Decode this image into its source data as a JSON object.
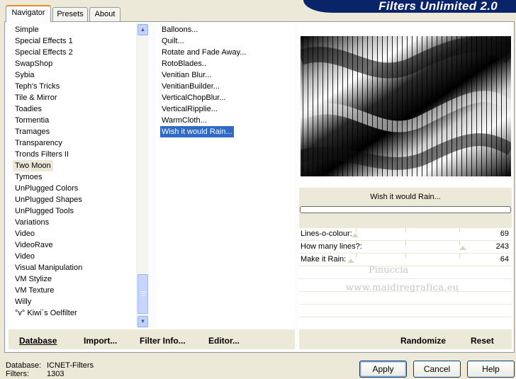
{
  "banner_title": "Filters Unlimited 2.0",
  "tabs": [
    "Navigator",
    "Presets",
    "About"
  ],
  "categories": [
    "Simple",
    "Special Effects 1",
    "Special Effects 2",
    "SwapShop",
    "Sybia",
    "Teph's Tricks",
    "Tile & Mirror",
    "Toadies",
    "Tormentia",
    "Tramages",
    "Transparency",
    "Tronds Filters II",
    "Two Moon",
    "Tymoes",
    "UnPlugged Colors",
    "UnPlugged Shapes",
    "UnPlugged Tools",
    "Variations",
    "Video",
    "VideoRave",
    "Video",
    "Visual Manipulation",
    "VM Stylize",
    "VM Texture",
    "Willy",
    "°v° Kiwi`s Oelfilter"
  ],
  "selected_category": "Two Moon",
  "filters": [
    "Balloons...",
    "Quilt...",
    "Rotate and Fade Away...",
    "RotoBlades..",
    "Venitian Blur...",
    "VenitianBuilder...",
    "VerticalChopBlur...",
    "VerticalRipplie...",
    "WarmCloth...",
    "Wish it would Rain..."
  ],
  "selected_filter": "Wish it would Rain...",
  "preview_filter_name": "Wish it would Rain...",
  "params": [
    {
      "label": "Lines-o-colour:",
      "value": "69"
    },
    {
      "label": "How many lines?:",
      "value": "243"
    },
    {
      "label": "Make it Rain:",
      "value": "64"
    }
  ],
  "watermark": {
    "line1": "Pinuccia",
    "line2": "www.maidiregrafica.eu"
  },
  "inner_buttons": {
    "database": "Database",
    "import": "Import...",
    "filter_info": "Filter Info...",
    "editor": "Editor...",
    "randomize": "Randomize",
    "reset": "Reset"
  },
  "status": {
    "database_label": "Database:",
    "database_value": "ICNET-Filters",
    "filters_label": "Filters:",
    "filters_value": "1303"
  },
  "buttons": {
    "apply": "Apply",
    "cancel": "Cancel",
    "help": "Help"
  },
  "colors": {
    "accent": "#316ac5",
    "banner": "#0a246a",
    "tab_highlight": "#e68b2c"
  }
}
